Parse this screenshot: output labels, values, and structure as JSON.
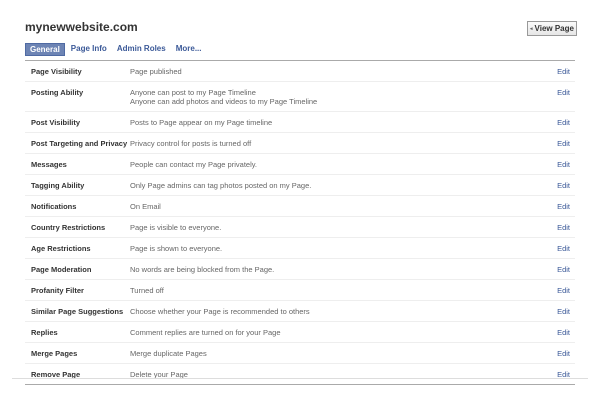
{
  "header": {
    "title": "mynewwebsite.com",
    "view_page": "View Page",
    "view_page_icon": "arrow-icon"
  },
  "tabs": [
    {
      "label": "General",
      "active": true
    },
    {
      "label": "Page Info"
    },
    {
      "label": "Admin Roles"
    },
    {
      "label": "More..."
    }
  ],
  "edit_label": "Edit",
  "rows": [
    {
      "label": "Page Visibility",
      "value": "Page published"
    },
    {
      "label": "Posting Ability",
      "value": "Anyone can post to my Page Timeline",
      "value2": "Anyone can add photos and videos to my Page Timeline"
    },
    {
      "label": "Post Visibility",
      "value": "Posts to Page appear on my Page timeline"
    },
    {
      "label": "Post Targeting and Privacy",
      "value": "Privacy control for posts is turned off"
    },
    {
      "label": "Messages",
      "value": "People can contact my Page privately."
    },
    {
      "label": "Tagging Ability",
      "value": "Only Page admins can tag photos posted on my Page."
    },
    {
      "label": "Notifications",
      "value": "On Email"
    },
    {
      "label": "Country Restrictions",
      "value": "Page is visible to everyone."
    },
    {
      "label": "Age Restrictions",
      "value": "Page is shown to everyone."
    },
    {
      "label": "Page Moderation",
      "value": "No words are being blocked from the Page."
    },
    {
      "label": "Profanity Filter",
      "value": "Turned off"
    },
    {
      "label": "Similar Page Suggestions",
      "value": "Choose whether your Page is recommended to others"
    },
    {
      "label": "Replies",
      "value": "Comment replies are turned on for your Page"
    },
    {
      "label": "Merge Pages",
      "value": "Merge duplicate Pages"
    },
    {
      "label": "Remove Page",
      "value": "Delete your Page"
    }
  ]
}
